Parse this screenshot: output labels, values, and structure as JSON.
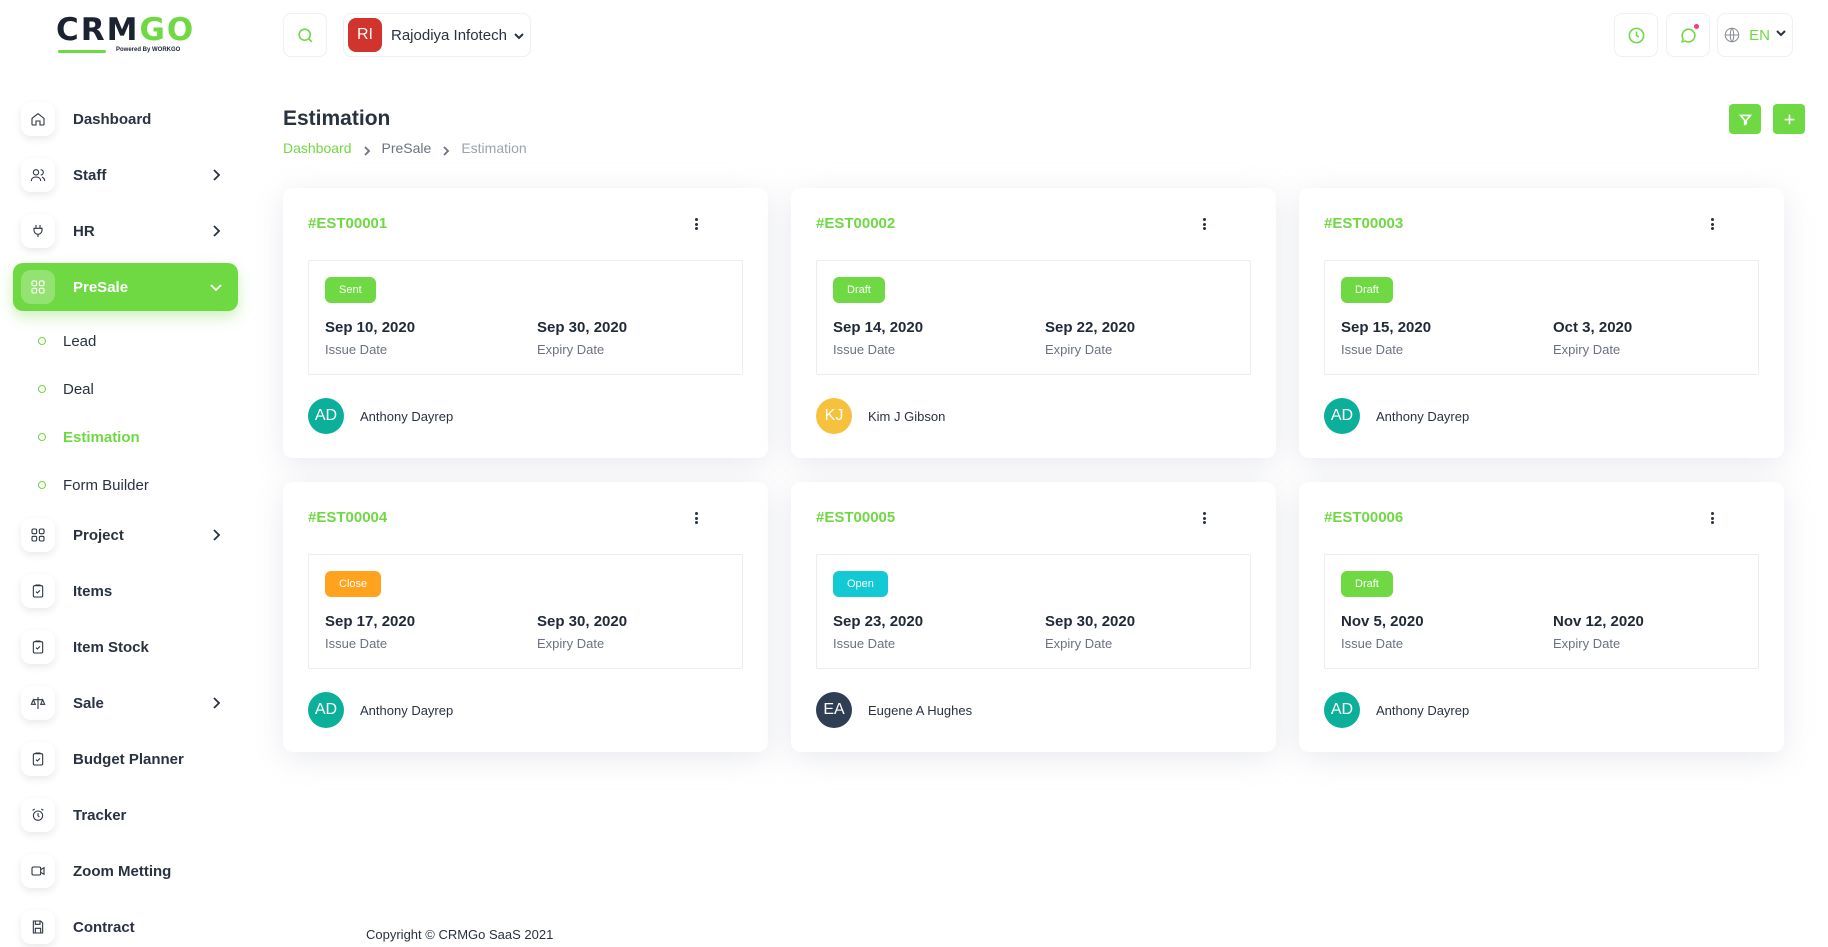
{
  "brand": {
    "logo_text_a": "CRM",
    "logo_text_b": "GO",
    "powered_by": "Powered By WORKGO",
    "accent": "#6fd943"
  },
  "sidebar": {
    "items": [
      {
        "label": "Dashboard",
        "icon": "home-icon"
      },
      {
        "label": "Staff",
        "icon": "users-icon"
      },
      {
        "label": "HR",
        "icon": "plug-icon"
      },
      {
        "label": "PreSale",
        "icon": "grid-icon"
      },
      {
        "label": "Project",
        "icon": "grid-icon"
      },
      {
        "label": "Items",
        "icon": "clipboard-icon"
      },
      {
        "label": "Item Stock",
        "icon": "clipboard-icon"
      },
      {
        "label": "Sale",
        "icon": "scale-icon"
      },
      {
        "label": "Budget Planner",
        "icon": "clipboard-icon"
      },
      {
        "label": "Tracker",
        "icon": "alarm-icon"
      },
      {
        "label": "Zoom Metting",
        "icon": "video-icon"
      },
      {
        "label": "Contract",
        "icon": "save-icon"
      }
    ],
    "presale_sub": [
      {
        "label": "Lead"
      },
      {
        "label": "Deal"
      },
      {
        "label": "Estimation"
      },
      {
        "label": "Form Builder"
      }
    ]
  },
  "header": {
    "company_initials": "RI",
    "company_name": "Rajodiya Infotech",
    "language": "EN"
  },
  "page": {
    "title": "Estimation",
    "breadcrumb": [
      "Dashboard",
      "PreSale",
      "Estimation"
    ]
  },
  "estimations": [
    {
      "id": "#EST00001",
      "status": "Sent",
      "status_color": "#6fd943",
      "issue_date": "Sep 10, 2020",
      "issue_label": "Issue Date",
      "expiry_date": "Sep 30, 2020",
      "expiry_label": "Expiry Date",
      "initials": "AD",
      "avatar_color": "#0caf9a",
      "assignee": "Anthony Dayrep"
    },
    {
      "id": "#EST00002",
      "status": "Draft",
      "status_color": "#6fd943",
      "issue_date": "Sep 14, 2020",
      "issue_label": "Issue Date",
      "expiry_date": "Sep 22, 2020",
      "expiry_label": "Expiry Date",
      "initials": "KJ",
      "avatar_color": "#f6c23e",
      "assignee": "Kim J Gibson"
    },
    {
      "id": "#EST00003",
      "status": "Draft",
      "status_color": "#6fd943",
      "issue_date": "Sep 15, 2020",
      "issue_label": "Issue Date",
      "expiry_date": "Oct 3, 2020",
      "expiry_label": "Expiry Date",
      "initials": "AD",
      "avatar_color": "#0caf9a",
      "assignee": "Anthony Dayrep"
    },
    {
      "id": "#EST00004",
      "status": "Close",
      "status_color": "#ffa21d",
      "issue_date": "Sep 17, 2020",
      "issue_label": "Issue Date",
      "expiry_date": "Sep 30, 2020",
      "expiry_label": "Expiry Date",
      "initials": "AD",
      "avatar_color": "#0caf9a",
      "assignee": "Anthony Dayrep"
    },
    {
      "id": "#EST00005",
      "status": "Open",
      "status_color": "#13c9d3",
      "issue_date": "Sep 23, 2020",
      "issue_label": "Issue Date",
      "expiry_date": "Sep 30, 2020",
      "expiry_label": "Expiry Date",
      "initials": "EA",
      "avatar_color": "#2f3e52",
      "assignee": "Eugene A Hughes"
    },
    {
      "id": "#EST00006",
      "status": "Draft",
      "status_color": "#6fd943",
      "issue_date": "Nov 5, 2020",
      "issue_label": "Issue Date",
      "expiry_date": "Nov 12, 2020",
      "expiry_label": "Expiry Date",
      "initials": "AD",
      "avatar_color": "#0caf9a",
      "assignee": "Anthony Dayrep"
    }
  ],
  "footer": {
    "copyright": "Copyright © CRMGo SaaS 2021"
  }
}
